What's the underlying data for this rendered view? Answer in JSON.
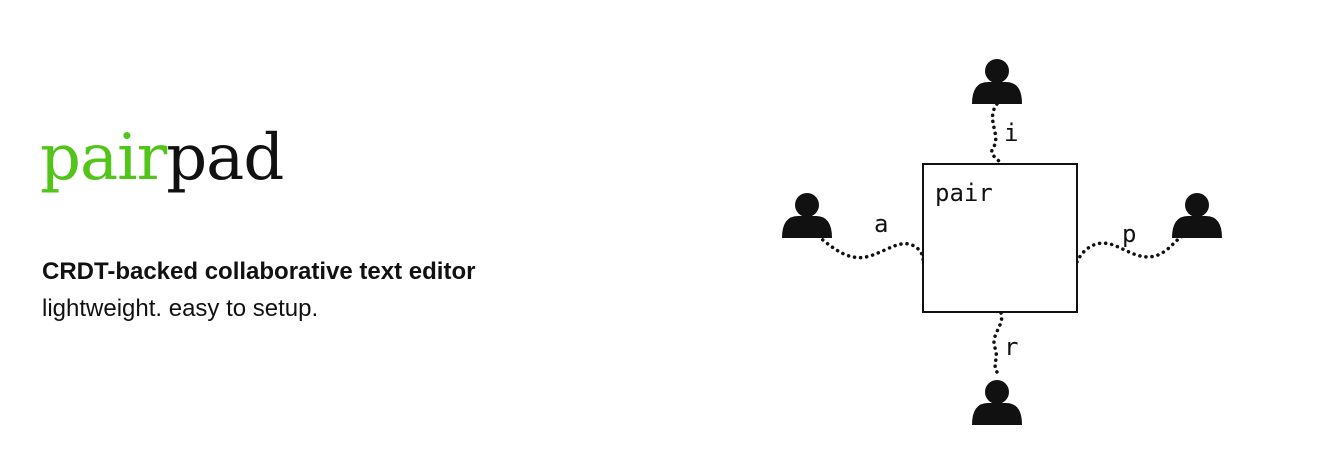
{
  "brand": {
    "name_accent": "pair",
    "name_rest": "pad",
    "accent_color": "#52c41a",
    "text_color": "#111111"
  },
  "tagline": "CRDT-backed collaborative text editor",
  "subline": "lightweight. easy to setup.",
  "diagram": {
    "document_text": "pair",
    "users": [
      {
        "id": "top",
        "char": "i",
        "icon": "user-icon"
      },
      {
        "id": "left",
        "char": "a",
        "icon": "user-icon"
      },
      {
        "id": "right",
        "char": "p",
        "icon": "user-icon"
      },
      {
        "id": "bottom",
        "char": "r",
        "icon": "user-icon"
      }
    ]
  }
}
